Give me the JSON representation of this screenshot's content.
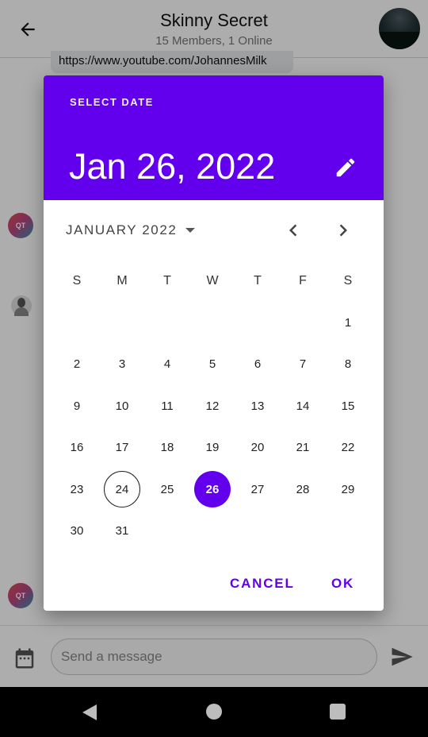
{
  "app": {
    "title": "Skinny Secret",
    "subtitle": "15 Members, 1 Online",
    "message_link": "https://www.youtube.com/JohannesMilk",
    "avatar_initials": "QT"
  },
  "composer": {
    "placeholder": "Send a message"
  },
  "dialog": {
    "caption": "SELECT DATE",
    "selected_date_display": "Jan 26, 2022",
    "month_label": "JANUARY 2022",
    "weekdays": [
      "S",
      "M",
      "T",
      "W",
      "T",
      "F",
      "S"
    ],
    "first_weekday_index": 6,
    "days_in_month": 31,
    "today": 24,
    "selected_day": 26,
    "cancel_label": "CANCEL",
    "ok_label": "OK"
  },
  "colors": {
    "accent": "#6200ee",
    "header_bg": "#6200ee"
  },
  "icons": {
    "back": "arrow-left-icon",
    "edit": "pencil-icon",
    "dropdown": "caret-down-icon",
    "prev": "chevron-left-icon",
    "next": "chevron-right-icon",
    "calendar": "calendar-icon",
    "send": "send-icon"
  }
}
